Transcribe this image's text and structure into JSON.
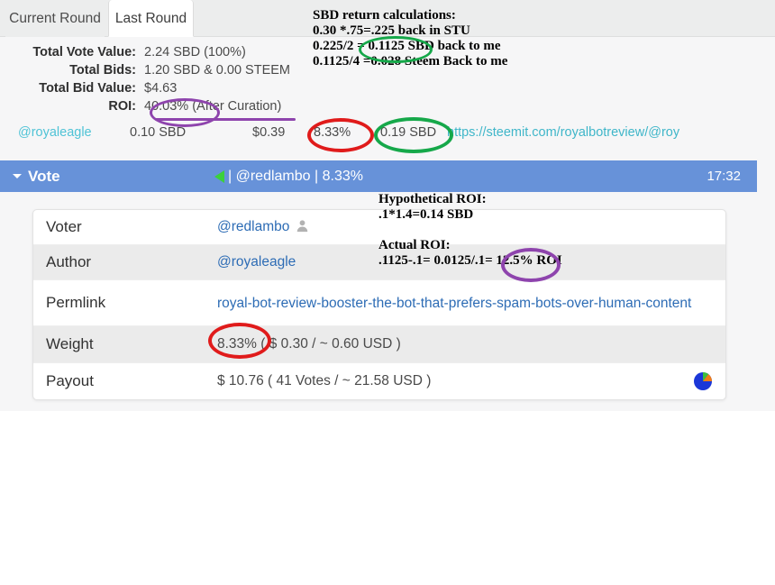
{
  "tabs": [
    {
      "label": "Current Round",
      "active": false
    },
    {
      "label": "Last Round",
      "active": true
    }
  ],
  "summary": {
    "rows": [
      {
        "label": "Total Vote Value:",
        "value": "2.24 SBD (100%)"
      },
      {
        "label": "Total Bids:",
        "value": "1.20 SBD & 0.00 STEEM"
      },
      {
        "label": "Total Bid Value:",
        "value": "$4.63"
      },
      {
        "label": "ROI:",
        "value": "40.03% (After Curation)"
      }
    ]
  },
  "bid_row": {
    "account": "@royaleagle",
    "amount": "0.10 SBD",
    "usd": "$0.39",
    "percent": "8.33%",
    "sbd_return": "0.19 SBD",
    "url": "https://steemit.com/royalbotreview/@roy"
  },
  "vote_bar": {
    "caret_icon": "caret-down-icon",
    "title": "Vote",
    "arrow_icon": "green-left-arrow-icon",
    "center": "| @redlambo | 8.33%",
    "time": "17:32",
    "color": "#6792d9"
  },
  "detail": {
    "rows": [
      {
        "key": "Voter",
        "value": "@redlambo",
        "icon": "person-avatar-icon",
        "link": true,
        "striped": false
      },
      {
        "key": "Author",
        "value": "@royaleagle",
        "link": true,
        "striped": true
      },
      {
        "key": "Permlink",
        "value": "royal-bot-review-booster-the-bot-that-prefers-spam-bots-over-human-content",
        "link": true,
        "striped": false
      },
      {
        "key": "Weight",
        "value": "8.33% ( $ 0.30 / ~ 0.60 USD )",
        "link": false,
        "striped": true
      },
      {
        "key": "Payout",
        "value": "$ 10.76 ( 41 Votes / ~ 21.58 USD )",
        "link": false,
        "striped": false,
        "icon": "pie-chart-icon"
      }
    ]
  },
  "annotations": {
    "sbd_calc": "SBD return calculations:\n0.30 *.75=.225 back in STU\n0.225/2 = 0.1125 SBD back to me\n0.1125/4 =0.028 Steem Back to me",
    "hypothetical_roi": "Hypothetical ROI:\n.1*1.4=0.14 SBD",
    "actual_roi": "Actual ROI:\n.1125-.1= 0.0125/.1= 12.5% ROI",
    "markers": [
      {
        "name": "ellipse-roi-40",
        "target": "40.03%",
        "color": "#8e44ad"
      },
      {
        "name": "underline-roi",
        "target": "ROI line",
        "color": "#8e44ad"
      },
      {
        "name": "ellipse-1125",
        "target": "0.1125",
        "color": "#16a84a"
      },
      {
        "name": "ellipse-bid-pct",
        "target": "8.33%",
        "color": "#e01b1b"
      },
      {
        "name": "ellipse-bid-sbd",
        "target": "0.19 SBD",
        "color": "#16a84a"
      },
      {
        "name": "ellipse-weight-pct",
        "target": "8.33%",
        "color": "#e01b1b"
      },
      {
        "name": "ellipse-125",
        "target": "12.5%",
        "color": "#8e44ad"
      }
    ]
  }
}
